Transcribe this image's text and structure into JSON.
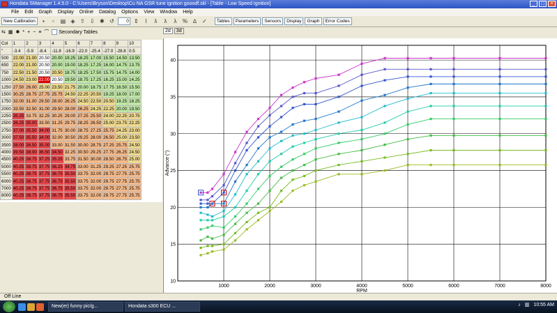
{
  "window": {
    "title": "Hondata SManager 1.4.5.0 - C:\\Users\\Bryson\\Desktop\\Cu NA GSR tune ignition gooodf.skl - [Table - Low Speed Ignition]"
  },
  "menu": [
    "File",
    "Edit",
    "Graph",
    "Display",
    "Online",
    "Datalog",
    "Options",
    "View",
    "Window",
    "Help"
  ],
  "toolbar": {
    "new_calibration": "New Calibration",
    "counter": "0",
    "buttons": [
      "Tables",
      "Parameters",
      "Sensors",
      "Display",
      "Graph",
      "Error Codes"
    ]
  },
  "toolbar2": {
    "secondary_tables": "Secondary Tables"
  },
  "tabs": [
    "2d",
    "3d"
  ],
  "table": {
    "header": [
      "Col",
      "1",
      "2",
      "3",
      "4",
      "5",
      "6",
      "7",
      "8",
      "9",
      "10"
    ],
    "load_row": [
      "\"",
      "-3.4",
      "-5.9",
      "-8.4",
      "-11.8",
      "-16.9",
      "-22.0",
      "-25.4",
      "-27.0",
      "-28.8",
      "0.5"
    ],
    "rows": [
      [
        "500",
        "22.00",
        "21.00",
        "20.50",
        "20.00",
        "19.25",
        "18.25",
        "17.00",
        "15.50",
        "14.50",
        "13.50"
      ],
      [
        "650",
        "22.00",
        "21.00",
        "20.50",
        "20.00",
        "19.00",
        "18.25",
        "17.25",
        "16.00",
        "14.75",
        "13.75"
      ],
      [
        "750",
        "22.50",
        "21.50",
        "20.50",
        "20.50",
        "18.75",
        "18.25",
        "17.50",
        "15.75",
        "14.75",
        "14.00"
      ],
      [
        "1000",
        "24.50",
        "23.00",
        "22.00",
        "20.50",
        "19.50",
        "18.75",
        "17.25",
        "16.25",
        "15.00",
        "14.25"
      ],
      [
        "1250",
        "27.50",
        "26.00",
        "25.00",
        "23.50",
        "21.75",
        "20.00",
        "18.75",
        "17.75",
        "16.50",
        "15.50"
      ],
      [
        "1500",
        "30.25",
        "28.75",
        "27.75",
        "25.75",
        "24.50",
        "22.25",
        "20.50",
        "19.25",
        "18.00",
        "17.00"
      ],
      [
        "1750",
        "32.00",
        "31.00",
        "29.50",
        "28.00",
        "26.25",
        "24.50",
        "22.50",
        "20.50",
        "19.25",
        "18.25"
      ],
      [
        "2000",
        "33.50",
        "32.50",
        "31.00",
        "29.50",
        "28.00",
        "26.25",
        "24.25",
        "22.25",
        "20.00",
        "19.50"
      ],
      [
        "2250",
        "35.25",
        "33.75",
        "32.25",
        "30.25",
        "29.00",
        "27.25",
        "25.50",
        "24.00",
        "22.25",
        "20.75"
      ],
      [
        "2500",
        "36.25",
        "35.00",
        "33.50",
        "31.25",
        "29.75",
        "28.25",
        "26.50",
        "25.00",
        "23.75",
        "22.25"
      ],
      [
        "2750",
        "37.00",
        "35.50",
        "34.00",
        "31.75",
        "30.00",
        "28.75",
        "27.25",
        "25.75",
        "24.25",
        "23.00"
      ],
      [
        "3000",
        "37.50",
        "35.50",
        "34.00",
        "32.00",
        "30.50",
        "29.25",
        "28.00",
        "26.50",
        "25.00",
        "23.50"
      ],
      [
        "3500",
        "38.00",
        "36.50",
        "35.00",
        "33.00",
        "31.50",
        "30.00",
        "28.75",
        "27.25",
        "25.75",
        "24.50"
      ],
      [
        "4000",
        "39.50",
        "38.00",
        "36.50",
        "34.50",
        "32.25",
        "30.50",
        "29.25",
        "27.75",
        "26.25",
        "24.50"
      ],
      [
        "4500",
        "40.25",
        "38.75",
        "37.25",
        "35.25",
        "33.75",
        "31.50",
        "30.00",
        "28.50",
        "26.75",
        "25.00"
      ],
      [
        "5000",
        "40.25",
        "38.75",
        "37.75",
        "36.25",
        "34.75",
        "33.00",
        "31.25",
        "29.25",
        "27.25",
        "25.75"
      ],
      [
        "5500",
        "40.25",
        "38.75",
        "37.75",
        "36.75",
        "35.50",
        "33.75",
        "32.00",
        "29.75",
        "27.75",
        "25.75"
      ],
      [
        "6000",
        "40.25",
        "38.75",
        "37.75",
        "36.75",
        "35.50",
        "33.75",
        "32.00",
        "29.75",
        "27.75",
        "25.75"
      ],
      [
        "7000",
        "40.25",
        "38.75",
        "37.75",
        "36.75",
        "35.50",
        "33.75",
        "32.00",
        "29.75",
        "27.75",
        "25.75"
      ],
      [
        "8000",
        "40.25",
        "38.75",
        "37.75",
        "36.75",
        "35.50",
        "33.75",
        "32.00",
        "29.75",
        "27.75",
        "25.75"
      ]
    ]
  },
  "colors": {
    "red": "#e8474a",
    "orange": "#f3b98a",
    "yellow": "#eed98f",
    "green": "#bfe7a5",
    "selected": "#dd0000"
  },
  "chart_data": {
    "type": "line",
    "xlabel": "RPM",
    "ylabel": "Advance (°)",
    "xlim": [
      0,
      8000
    ],
    "ylim": [
      10,
      42
    ],
    "xticks": [
      1000,
      2000,
      3000,
      4000,
      5000,
      6000,
      7000,
      8000
    ],
    "yticks": [
      10,
      15,
      20,
      25,
      30,
      35,
      40
    ],
    "x": [
      500,
      650,
      750,
      1000,
      1250,
      1500,
      1750,
      2000,
      2250,
      2500,
      2750,
      3000,
      3500,
      4000,
      4500,
      5000,
      5500,
      6000,
      7000,
      8000
    ],
    "series_colors": [
      "#cc33cc",
      "#5555cc",
      "#3355cc",
      "#2277cc",
      "#22bbcc",
      "#22ccaa",
      "#33cc66",
      "#44bb44",
      "#77bb22",
      "#99bb22"
    ],
    "series": [
      {
        "values": [
          22.0,
          22.0,
          22.5,
          24.5,
          27.5,
          30.25,
          32.0,
          33.5,
          35.25,
          36.25,
          37.0,
          37.5,
          38.0,
          39.5,
          40.25,
          40.25,
          40.25,
          40.25,
          40.25,
          40.25
        ]
      },
      {
        "values": [
          21.0,
          21.0,
          21.5,
          23.0,
          26.0,
          28.75,
          31.0,
          32.5,
          33.75,
          35.0,
          35.5,
          35.5,
          36.5,
          38.0,
          38.75,
          38.75,
          38.75,
          38.75,
          38.75,
          38.75
        ]
      },
      {
        "values": [
          20.5,
          20.5,
          20.5,
          22.0,
          25.0,
          27.75,
          29.5,
          31.0,
          32.25,
          33.5,
          34.0,
          34.0,
          35.0,
          36.5,
          37.25,
          37.75,
          37.75,
          37.75,
          37.75,
          37.75
        ]
      },
      {
        "values": [
          20.0,
          20.0,
          20.5,
          20.5,
          23.5,
          25.75,
          28.0,
          29.5,
          30.25,
          31.25,
          31.75,
          32.0,
          33.0,
          34.5,
          35.25,
          36.25,
          36.75,
          36.75,
          36.75,
          36.75
        ]
      },
      {
        "values": [
          19.25,
          19.0,
          18.75,
          19.5,
          21.75,
          24.5,
          26.25,
          28.0,
          29.0,
          29.75,
          30.0,
          30.5,
          31.5,
          32.25,
          33.75,
          34.75,
          35.5,
          35.5,
          35.5,
          35.5
        ]
      },
      {
        "values": [
          18.25,
          18.25,
          18.25,
          18.75,
          20.0,
          22.25,
          24.5,
          26.25,
          27.25,
          28.25,
          28.75,
          29.25,
          30.0,
          30.5,
          31.5,
          33.0,
          33.75,
          33.75,
          33.75,
          33.75
        ]
      },
      {
        "values": [
          17.0,
          17.25,
          17.5,
          17.25,
          18.75,
          20.5,
          22.5,
          24.25,
          25.5,
          26.5,
          27.25,
          28.0,
          28.75,
          29.25,
          30.0,
          31.25,
          32.0,
          32.0,
          32.0,
          32.0
        ]
      },
      {
        "values": [
          15.5,
          16.0,
          15.75,
          16.25,
          17.75,
          19.25,
          20.5,
          22.25,
          24.0,
          25.0,
          25.75,
          26.5,
          27.25,
          27.75,
          28.5,
          29.25,
          29.75,
          29.75,
          29.75,
          29.75
        ]
      },
      {
        "values": [
          14.5,
          14.75,
          14.75,
          15.0,
          16.5,
          18.0,
          19.25,
          20.0,
          22.25,
          23.75,
          24.25,
          25.0,
          25.75,
          26.25,
          26.75,
          27.25,
          27.75,
          27.75,
          27.75,
          27.75
        ]
      },
      {
        "values": [
          13.5,
          13.75,
          14.0,
          14.25,
          15.5,
          17.0,
          18.25,
          19.5,
          20.75,
          22.25,
          23.0,
          23.5,
          24.5,
          24.5,
          25.0,
          25.75,
          25.75,
          25.75,
          25.75,
          25.75
        ]
      }
    ]
  },
  "status": {
    "text": "Off Line"
  },
  "taskbar": {
    "items": [
      "New(er) funny pic/g...",
      "Hondata s300 ECU ..."
    ],
    "clock": "10:55 AM"
  }
}
